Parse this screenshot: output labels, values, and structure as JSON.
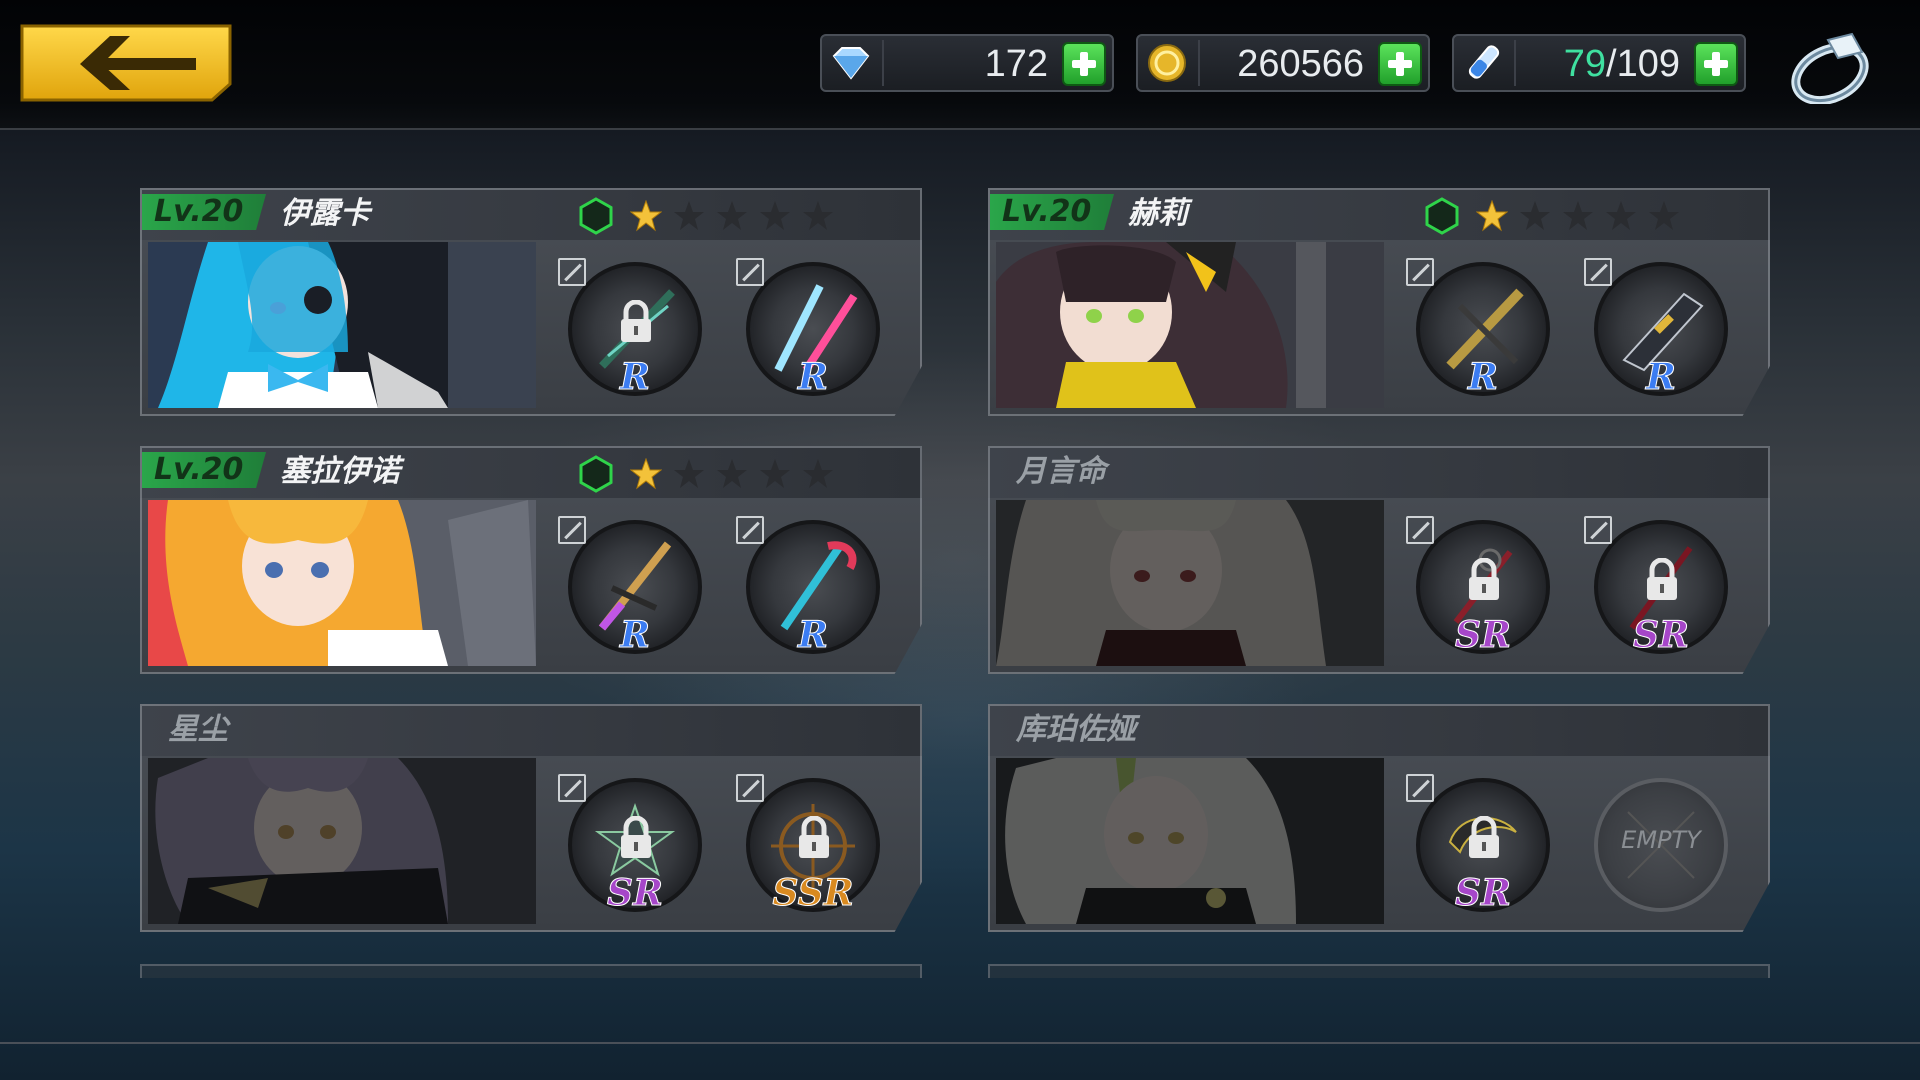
{
  "topbar": {
    "back_label": "",
    "resources": [
      {
        "name": "diamond",
        "icon": "diamond-icon",
        "value": "172"
      },
      {
        "name": "gold",
        "icon": "coin-icon",
        "value": "260566"
      },
      {
        "name": "stamina",
        "icon": "stamina-vial-icon",
        "value_current": "79",
        "value_sep": "/",
        "value_max": "109"
      }
    ],
    "ring_icon": "ring-icon"
  },
  "characters": [
    {
      "name": "伊露卡",
      "level": "Lv.20",
      "unlocked": true,
      "stars": 1,
      "max_stars": 5,
      "weapons": [
        {
          "rarity": "R",
          "locked": true
        },
        {
          "rarity": "R",
          "locked": false
        }
      ]
    },
    {
      "name": "赫莉",
      "level": "Lv.20",
      "unlocked": true,
      "stars": 1,
      "max_stars": 5,
      "weapons": [
        {
          "rarity": "R",
          "locked": false
        },
        {
          "rarity": "R",
          "locked": false
        }
      ]
    },
    {
      "name": "塞拉伊诺",
      "level": "Lv.20",
      "unlocked": true,
      "stars": 1,
      "max_stars": 5,
      "weapons": [
        {
          "rarity": "R",
          "locked": false
        },
        {
          "rarity": "R",
          "locked": false
        }
      ]
    },
    {
      "name": "月言命",
      "level": "",
      "unlocked": false,
      "weapons": [
        {
          "rarity": "SR",
          "locked": true
        },
        {
          "rarity": "SR",
          "locked": true
        }
      ]
    },
    {
      "name": "星尘",
      "level": "",
      "unlocked": false,
      "weapons": [
        {
          "rarity": "SR",
          "locked": true
        },
        {
          "rarity": "SSR",
          "locked": true
        }
      ]
    },
    {
      "name": "库珀佐娅",
      "level": "",
      "unlocked": false,
      "weapons": [
        {
          "rarity": "SR",
          "locked": true
        },
        {
          "rarity": "",
          "locked": false,
          "empty": true,
          "empty_label": "EMPTY"
        }
      ]
    }
  ],
  "colors": {
    "level_badge": "#2aa64a",
    "star_gold": "#f3c23a",
    "plus_green": "#33c23c",
    "stamina_current": "#3fe0a0",
    "back_yellow": "#f2c21a"
  }
}
